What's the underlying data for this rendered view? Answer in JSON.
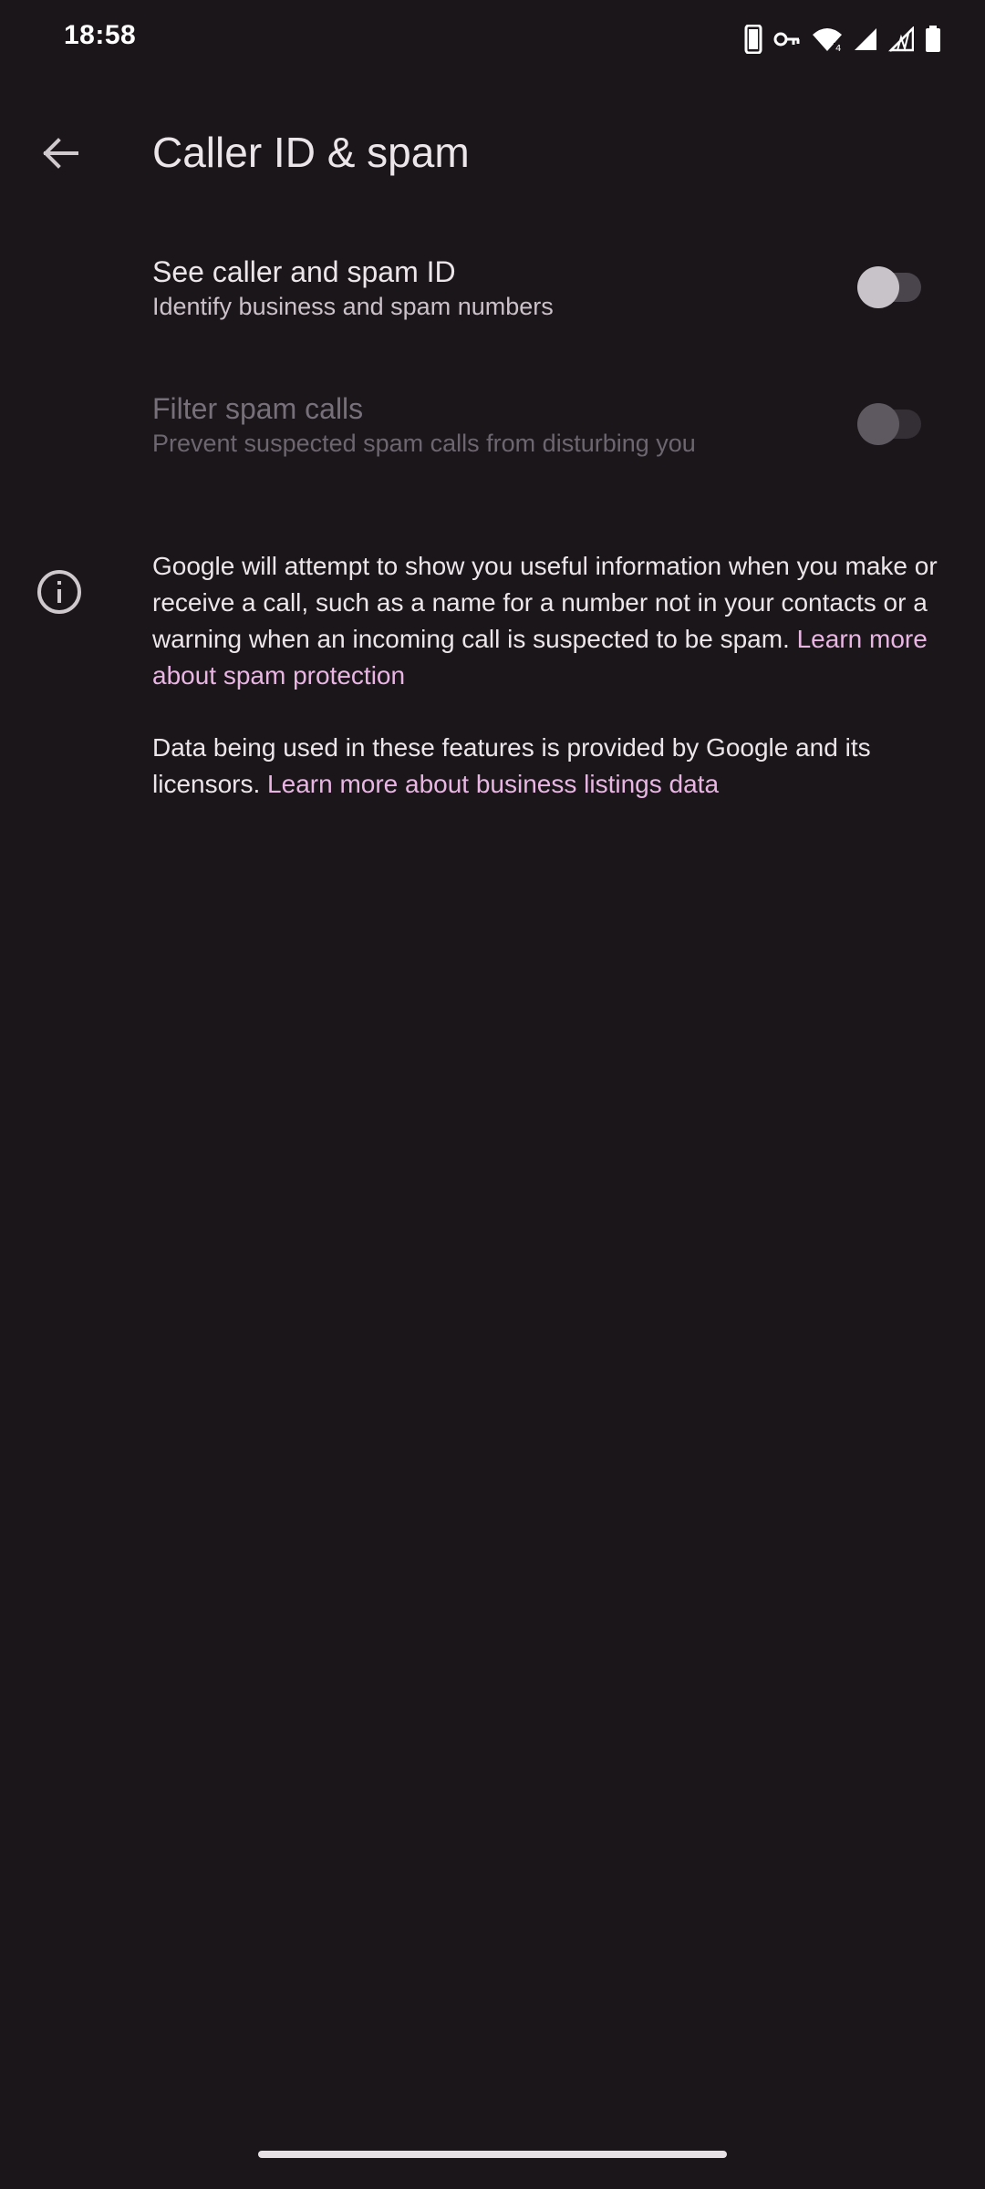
{
  "status_bar": {
    "time": "18:58",
    "icons": [
      "phone-icon",
      "vpn-key-icon",
      "wifi-icon",
      "cell-signal-icon",
      "data-off-icon",
      "battery-icon"
    ]
  },
  "app_bar": {
    "title": "Caller ID & spam",
    "back_icon": "arrow-back-icon"
  },
  "settings": [
    {
      "title": "See caller and spam ID",
      "subtitle": "Identify business and spam numbers",
      "enabled": true,
      "checked": false
    },
    {
      "title": "Filter spam calls",
      "subtitle": "Prevent suspected spam calls from disturbing you",
      "enabled": false,
      "checked": false
    }
  ],
  "info": {
    "icon": "info-icon",
    "paragraph1_text": "Google will attempt to show you useful information when you make or receive a call, such as a name for a number not in your contacts or a warning when an incoming call is suspected to be spam.",
    "paragraph1_link": "Learn more about spam protection",
    "paragraph2_text": "Data being used in these features is provided by Google and its licensors.",
    "paragraph2_link": "Learn more about business listings data"
  },
  "colors": {
    "background": "#1a161a",
    "link": "#e9b6e4",
    "text_primary": "#ece5ea",
    "text_secondary": "#cbc2c9"
  }
}
